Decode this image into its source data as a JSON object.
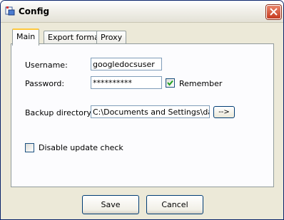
{
  "window": {
    "title": "Config",
    "app_icon": "app-config-icon",
    "close_icon": "close-icon"
  },
  "tabs": [
    {
      "label": "Main",
      "selected": true
    },
    {
      "label": "Export format",
      "selected": false
    },
    {
      "label": "Proxy",
      "selected": false
    }
  ],
  "main": {
    "username_label": "Username:",
    "username_value": "googledocsuser",
    "password_label": "Password:",
    "password_value": "**********",
    "remember_label": "Remember",
    "remember_checked": true,
    "backup_label": "Backup directory:",
    "backup_value": "C:\\Documents and Settings\\dav\\",
    "browse_label": "-->",
    "disable_update_label": "Disable update check",
    "disable_update_checked": false
  },
  "buttons": {
    "save": "Save",
    "cancel": "Cancel"
  },
  "colors": {
    "tab_highlight": "#ffc83c",
    "close_button": "#c5391f",
    "checkmark": "#21a121"
  }
}
